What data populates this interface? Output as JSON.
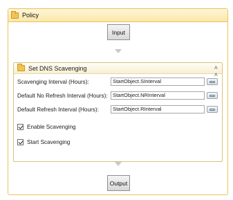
{
  "policy": {
    "title": "Policy",
    "icon": "folder-icon",
    "input_label": "Input",
    "output_label": "Output"
  },
  "scavenging": {
    "title": "Set DNS Scavenging",
    "icon": "folder-icon",
    "collapse_icon": "double-chevron-up-icon",
    "fields": [
      {
        "label": "Scavenging Interval (Hours):",
        "value": "StartObject.SInterval"
      },
      {
        "label": "Default No Refresh Interval (Hours):",
        "value": "StartObject.NRInterval"
      },
      {
        "label": "Default Refresh Interval (Hours):",
        "value": "StartObject.RInterval"
      }
    ],
    "checkboxes": [
      {
        "label": "Enable Scavenging",
        "checked": true
      },
      {
        "label": "Start Scavenging",
        "checked": true
      }
    ]
  },
  "colors": {
    "border": "#e8c35a",
    "header_bg": "#fbe7a8"
  }
}
